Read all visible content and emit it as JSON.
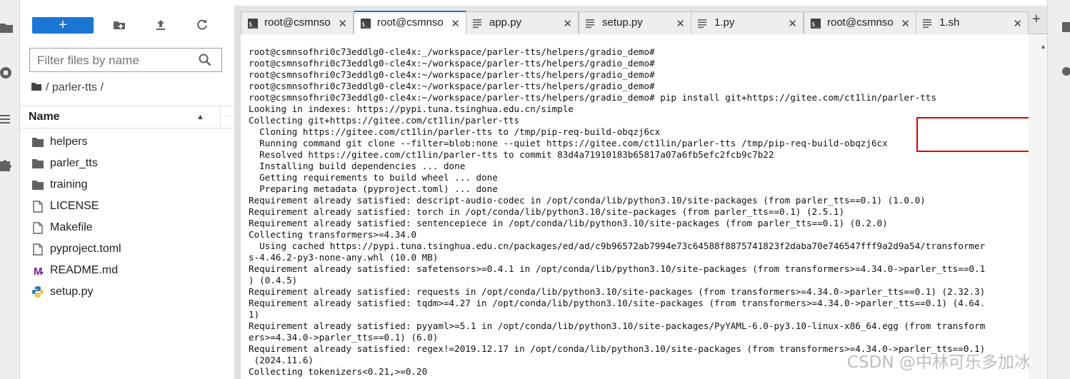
{
  "toolbar": {
    "new_label": "+"
  },
  "filter": {
    "placeholder": "Filter files by name"
  },
  "breadcrumb": {
    "path": "/ parler-tts /"
  },
  "file_list": {
    "header_name": "Name",
    "items": [
      {
        "name": "helpers",
        "icon": "folder-icon"
      },
      {
        "name": "parler_tts",
        "icon": "folder-icon"
      },
      {
        "name": "training",
        "icon": "folder-icon"
      },
      {
        "name": "LICENSE",
        "icon": "file-icon"
      },
      {
        "name": "Makefile",
        "icon": "file-icon"
      },
      {
        "name": "pyproject.toml",
        "icon": "file-icon"
      },
      {
        "name": "README.md",
        "icon": "markdown-icon"
      },
      {
        "name": "setup.py",
        "icon": "python-icon"
      }
    ]
  },
  "tabs": [
    {
      "label": "root@csmnso",
      "icon": "terminal-icon",
      "active": false
    },
    {
      "label": "root@csmnso",
      "icon": "terminal-icon",
      "active": true
    },
    {
      "label": "app.py",
      "icon": "text-file-icon",
      "active": false
    },
    {
      "label": "setup.py",
      "icon": "text-file-icon",
      "active": false
    },
    {
      "label": "1.py",
      "icon": "text-file-icon",
      "active": false
    },
    {
      "label": "root@csmnso",
      "icon": "terminal-icon",
      "active": false
    },
    {
      "label": "1.sh",
      "icon": "text-file-icon",
      "active": false
    }
  ],
  "terminal": {
    "lines": [
      "root@csmnsofhri0c73eddlg0-cle4x:_/workspace/parler-tts/helpers/gradio_demo#",
      "root@csmnsofhri0c73eddlg0-cle4x:~/workspace/parler-tts/helpers/gradio_demo#",
      "root@csmnsofhri0c73eddlg0-cle4x:~/workspace/parler-tts/helpers/gradio_demo#",
      "root@csmnsofhri0c73eddlg0-cle4x:~/workspace/parler-tts/helpers/gradio_demo#",
      "root@csmnsofhri0c73eddlg0-cle4x:~/workspace/parler-tts/helpers/gradio_demo# pip install git+https://gitee.com/ct1lin/parler-tts",
      "Looking in indexes: https://pypi.tuna.tsinghua.edu.cn/simple",
      "Collecting git+https://gitee.com/ct1lin/parler-tts",
      "  Cloning https://gitee.com/ct1lin/parler-tts to /tmp/pip-req-build-obqzj6cx",
      "  Running command git clone --filter=blob:none --quiet https://gitee.com/ct1lin/parler-tts /tmp/pip-req-build-obqzj6cx",
      "  Resolved https://gitee.com/ct1lin/parler-tts to commit 83d4a71910183b65817a07a6fb5efc2fcb9c7b22",
      "  Installing build dependencies ... done",
      "  Getting requirements to build wheel ... done",
      "  Preparing metadata (pyproject.toml) ... done",
      "Requirement already satisfied: descript-audio-codec in /opt/conda/lib/python3.10/site-packages (from parler_tts==0.1) (1.0.0)",
      "Requirement already satisfied: torch in /opt/conda/lib/python3.10/site-packages (from parler_tts==0.1) (2.5.1)",
      "Requirement already satisfied: sentencepiece in /opt/conda/lib/python3.10/site-packages (from parler_tts==0.1) (0.2.0)",
      "Collecting transformers>=4.34.0",
      "  Using cached https://pypi.tuna.tsinghua.edu.cn/packages/ed/ad/c9b96572ab7994e73c64588f8875741823f2daba70e746547fff9a2d9a54/transformer",
      "s-4.46.2-py3-none-any.whl (10.0 MB)",
      "Requirement already satisfied: safetensors>=0.4.1 in /opt/conda/lib/python3.10/site-packages (from transformers>=4.34.0->parler_tts==0.1",
      ") (0.4.5)",
      "Requirement already satisfied: requests in /opt/conda/lib/python3.10/site-packages (from transformers>=4.34.0->parler_tts==0.1) (2.32.3)",
      "Requirement already satisfied: tqdm>=4.27 in /opt/conda/lib/python3.10/site-packages (from transformers>=4.34.0->parler_tts==0.1) (4.64.",
      "1)",
      "Requirement already satisfied: pyyaml>=5.1 in /opt/conda/lib/python3.10/site-packages/PyYAML-6.0-py3.10-linux-x86_64.egg (from transform",
      "ers>=4.34.0->parler_tts==0.1) (6.0)",
      "Requirement already satisfied: regex!=2019.12.17 in /opt/conda/lib/python3.10/site-packages (from transformers>=4.34.0->parler_tts==0.1)",
      " (2024.11.6)",
      "Collecting tokenizers<0.21,>=0.20"
    ]
  },
  "watermark": "CSDN @中林可乐多加冰",
  "colors": {
    "accent": "#1976d2",
    "highlight_box": "#e00000"
  }
}
